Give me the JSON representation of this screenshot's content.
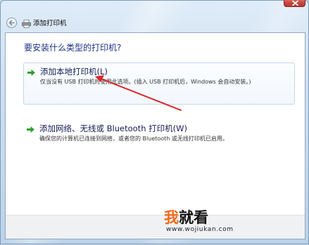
{
  "window": {
    "title": "添加打印机",
    "title_icon": "printer-icon",
    "back_button_icon": "back-arrow-icon",
    "close_button_icon": "close-icon"
  },
  "content": {
    "heading": "要安装什么类型的打印机?",
    "options": [
      {
        "icon": "green-arrow-icon",
        "label": "添加本地打印机(L)",
        "description": "仅当没有 USB 打印机时使用此选项。(插入 USB 打印机后，Windows 会自动安装。)",
        "highlighted": true
      },
      {
        "icon": "green-arrow-icon",
        "label": "添加网络、无线或 Bluetooth 打印机(W)",
        "description": "确保您的计算机已连接到网络，或者您的 Bluetooth 或无线打印机已启用。",
        "highlighted": false
      }
    ]
  },
  "annotation": {
    "icon": "red-arrow-annotation"
  },
  "watermark": {
    "mark": "我",
    "text": "就看",
    "url": "www.wojiukan.com"
  },
  "colors": {
    "heading": "#1e3287",
    "link": "#151c55",
    "arrow": "#d9272b",
    "mark": "#ef6a1a",
    "close": "#c94c43",
    "green_arrow": "#2f9e2f"
  }
}
